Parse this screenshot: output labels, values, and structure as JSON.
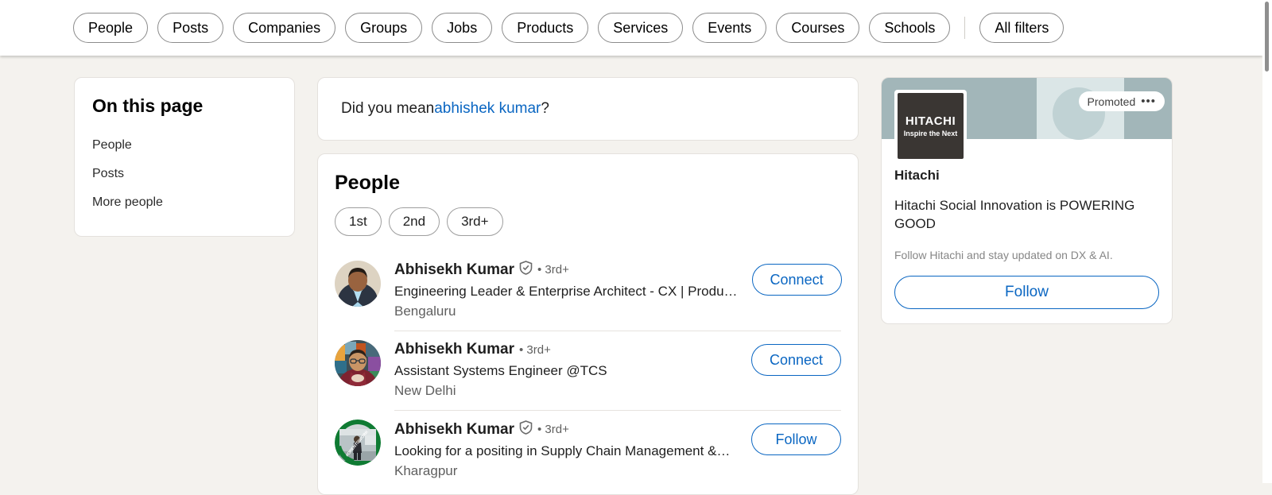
{
  "header": {
    "filters": [
      {
        "label": "People"
      },
      {
        "label": "Posts"
      },
      {
        "label": "Companies"
      },
      {
        "label": "Groups"
      },
      {
        "label": "Jobs"
      },
      {
        "label": "Products"
      },
      {
        "label": "Services"
      },
      {
        "label": "Events"
      },
      {
        "label": "Courses"
      },
      {
        "label": "Schools"
      }
    ],
    "all_filters_label": "All filters"
  },
  "sidebar": {
    "title": "On this page",
    "items": [
      {
        "label": "People"
      },
      {
        "label": "Posts"
      },
      {
        "label": "More people"
      }
    ]
  },
  "did_you_mean": {
    "prefix": "Did you mean ",
    "suggestion": "abhishek kumar",
    "suffix": "?"
  },
  "results": {
    "section_title": "People",
    "degree_filters": [
      {
        "label": "1st"
      },
      {
        "label": "2nd"
      },
      {
        "label": "3rd+"
      }
    ],
    "people": [
      {
        "name": "Abhisekh Kumar",
        "verified": true,
        "degree": "• 3rd+",
        "headline": "Engineering Leader & Enterprise Architect - CX | Produ…",
        "location": "Bengaluru",
        "action": "Connect"
      },
      {
        "name": "Abhisekh Kumar",
        "verified": false,
        "degree": "• 3rd+",
        "headline": "Assistant Systems Engineer @TCS",
        "location": "New Delhi",
        "action": "Connect"
      },
      {
        "name": "Abhisekh Kumar",
        "verified": true,
        "degree": "• 3rd+",
        "headline": "Looking for a positing in Supply Chain Management &…",
        "location": "Kharagpur",
        "action": "Follow"
      }
    ]
  },
  "ad": {
    "promoted_label": "Promoted",
    "menu_glyph": "•••",
    "logo_main": "HITACHI",
    "logo_sub": "Inspire the Next",
    "company": "Hitachi",
    "tagline": "Hitachi Social Innovation is POWERING GOOD",
    "subtext": "Follow Hitachi and stay updated on DX & AI.",
    "follow_label": "Follow"
  },
  "colors": {
    "linkedin_blue": "#0a66c2",
    "page_bg": "#f4f2ee",
    "card_bg": "#ffffff",
    "banner_teal": "#a2b6b9",
    "banner_light": "#dbe6e7",
    "logo_dark": "#3a3633",
    "opentowork_green": "#0f7b33"
  }
}
